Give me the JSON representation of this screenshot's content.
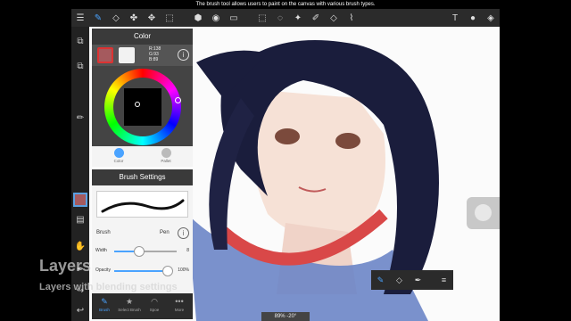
{
  "caption": "The brush tool allows users to paint on the canvas with various brush types.",
  "top_toolbar": {
    "items": [
      {
        "icon": "menu-icon",
        "glyph": "☰"
      },
      {
        "icon": "brush-icon",
        "glyph": "✎",
        "active": true
      },
      {
        "icon": "eraser-icon",
        "glyph": "◇"
      },
      {
        "icon": "smudge-icon",
        "glyph": "✤"
      },
      {
        "icon": "move-icon",
        "glyph": "✥"
      },
      {
        "icon": "transform-icon",
        "glyph": "⬚"
      },
      {
        "icon": "fill-icon",
        "glyph": "⬢"
      },
      {
        "icon": "bucket-icon",
        "glyph": "◉"
      },
      {
        "icon": "gradient-icon",
        "glyph": "▭"
      },
      {
        "icon": "select-rect-icon",
        "glyph": "⬚"
      },
      {
        "icon": "select-lasso-icon",
        "glyph": "◌"
      },
      {
        "icon": "magic-wand-icon",
        "glyph": "✦"
      },
      {
        "icon": "select-pen-icon",
        "glyph": "✐"
      },
      {
        "icon": "select-eraser-icon",
        "glyph": "◇"
      },
      {
        "icon": "eyedropper-icon",
        "glyph": "⌇"
      },
      {
        "icon": "text-icon",
        "glyph": "T"
      },
      {
        "icon": "comment-icon",
        "glyph": "●"
      },
      {
        "icon": "layers-icon",
        "glyph": "◈"
      }
    ]
  },
  "left_toolbar": {
    "items": [
      {
        "icon": "copy-icon",
        "glyph": "⧉"
      },
      {
        "icon": "paste-icon",
        "glyph": "⧉"
      },
      {
        "icon": "ruler-icon",
        "glyph": "✏"
      },
      {
        "icon": "color-swatch-icon",
        "glyph": ""
      },
      {
        "icon": "layer-panel-icon",
        "glyph": "▤"
      },
      {
        "icon": "hand-icon",
        "glyph": "✋"
      },
      {
        "icon": "eyedropper-icon",
        "glyph": "✒"
      },
      {
        "icon": "redo-icon",
        "glyph": "↪"
      },
      {
        "icon": "undo-icon",
        "glyph": "↩"
      }
    ]
  },
  "color_panel": {
    "title": "Color",
    "primary_color": "#a55a5e",
    "secondary_color": "#f2f2f2",
    "rgb": {
      "r": "R:138",
      "g": "G:93",
      "b": "B:89"
    },
    "modes": [
      {
        "label": "Color",
        "icon": "color-wheel-icon",
        "active": true
      },
      {
        "label": "Pallet",
        "icon": "palette-icon",
        "active": false
      }
    ]
  },
  "brush_panel": {
    "title": "Brush Settings",
    "brush_category": "Brush",
    "brush_name": "Pen",
    "width": {
      "label": "Width",
      "value": "8",
      "fraction": 0.4
    },
    "opacity": {
      "label": "Opacity",
      "value": "100%",
      "fraction": 1.0
    },
    "tabs": [
      {
        "label": "Brush",
        "icon": "brush-tab-icon",
        "glyph": "✎",
        "active": true
      },
      {
        "label": "Select Brush",
        "icon": "star-icon",
        "glyph": "★",
        "active": false
      },
      {
        "label": "Spoe",
        "icon": "spray-icon",
        "glyph": "◠",
        "active": false
      },
      {
        "label": "More",
        "icon": "more-icon",
        "glyph": "•••",
        "active": false
      }
    ]
  },
  "watermark": {
    "title": "Layers",
    "subtitle": "Layers with blending settings"
  },
  "zoom_label": "89% -20°",
  "quick_toolbar": {
    "items": [
      {
        "icon": "brush-icon",
        "glyph": "✎",
        "active": true
      },
      {
        "icon": "eraser-icon",
        "glyph": "◇"
      },
      {
        "icon": "eyedropper-icon",
        "glyph": "✒"
      },
      {
        "icon": "menu-icon",
        "glyph": "≡"
      }
    ]
  },
  "colors": {
    "accent": "#4aa3ff",
    "toolbar": "#2b2b2b",
    "panel": "#f4f4f4"
  }
}
